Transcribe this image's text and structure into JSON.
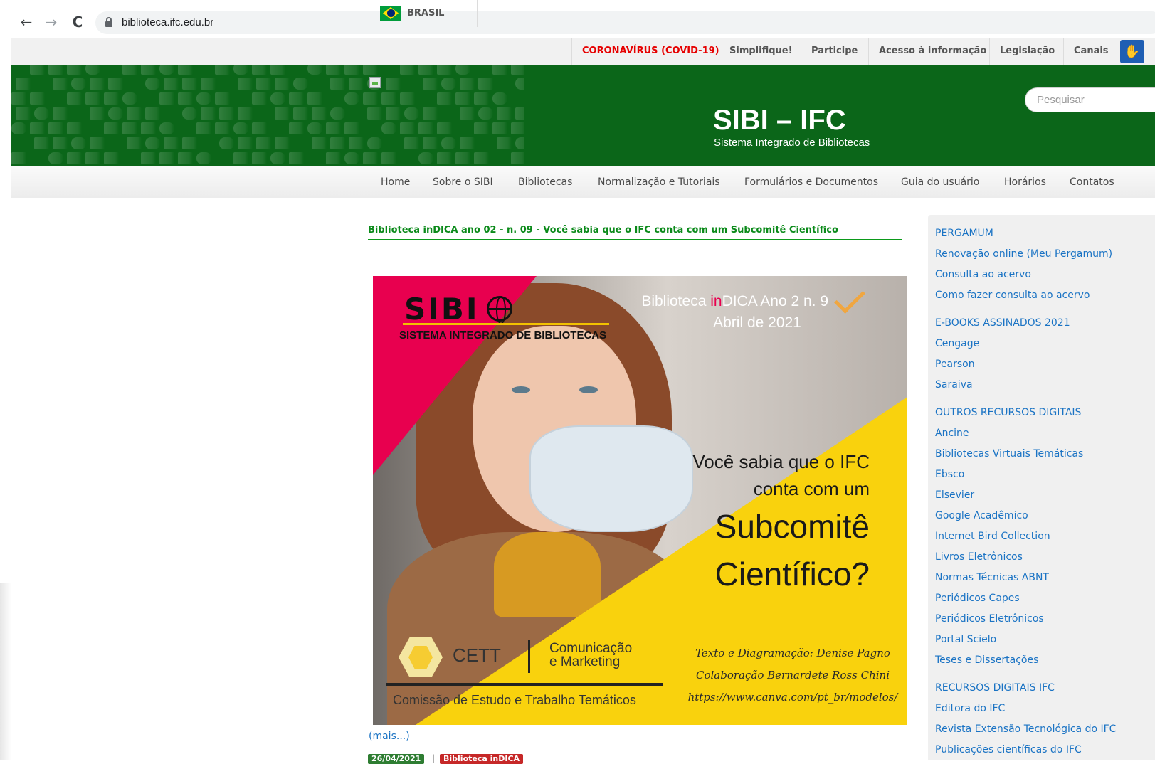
{
  "browser": {
    "back_icon": "←",
    "forward_icon": "→",
    "reload_icon": "C",
    "url": "biblioteca.ifc.edu.br"
  },
  "govbar": {
    "country": "BRASIL",
    "links": [
      "CORONAVÍRUS (COVID-19)",
      "Simplifique!",
      "Participe",
      "Acesso à informação",
      "Legislação",
      "Canais"
    ],
    "accessibility_icon": "✋"
  },
  "header": {
    "title": "SIBI – IFC",
    "subtitle": "Sistema Integrado de Bibliotecas",
    "search_placeholder": "Pesquisar"
  },
  "menu": [
    "Home",
    "Sobre o SIBI",
    "Bibliotecas",
    "Normalização e Tutoriais",
    "Formulários e Documentos",
    "Guia do usuário",
    "Horários",
    "Contatos"
  ],
  "post": {
    "title": "Biblioteca inDICA ano 02 - n. 09 - Você sabia que o IFC conta com um Subcomitê Científico",
    "more": "(mais...)",
    "date": "26/04/2021",
    "separator": "|",
    "tag": "Biblioteca inDICA"
  },
  "poster": {
    "logo": "SIBI",
    "logo_sub": "SISTEMA INTEGRADO DE BIBLIOTECAS",
    "issue_prefix": "Biblioteca ",
    "issue_highlight": "in",
    "issue_suffix": "DICA Ano 2 n. 9",
    "issue_date": "Abril de 2021",
    "question_line1": "Você sabia que o IFC",
    "question_line2": "conta com um",
    "question_line3": "Subcomitê",
    "question_line4": "Científico?",
    "credit1": "Texto e Diagramação: Denise Pagno",
    "credit2": "Colaboração Bernardete Ross Chini",
    "credit3": "https://www.canva.com/pt_br/modelos/",
    "cett": "CETT",
    "cett_dept1": "Comunicação",
    "cett_dept2": "e Marketing",
    "cett_full": "Comissão de Estudo e Trabalho Temáticos"
  },
  "sidebar": [
    "PERGAMUM",
    "Renovação online (Meu Pergamum)",
    "Consulta ao acervo",
    "Como fazer consulta ao acervo",
    "E-BOOKS ASSINADOS 2021",
    "Cengage",
    "Pearson",
    "Saraiva",
    "OUTROS RECURSOS DIGITAIS",
    "Ancine",
    "Bibliotecas Virtuais Temáticas",
    "Ebsco",
    "Elsevier",
    "Google Acadêmico",
    "Internet Bird Collection",
    "Livros Eletrônicos",
    "Normas Técnicas ABNT",
    "Periódicos Capes",
    "Periódicos Eletrônicos",
    "Portal Scielo",
    "Teses e Dissertações",
    "RECURSOS DIGITAIS IFC",
    "Editora do IFC",
    "Revista Extensão Tecnológica do IFC",
    "Publicações científicas do IFC"
  ]
}
